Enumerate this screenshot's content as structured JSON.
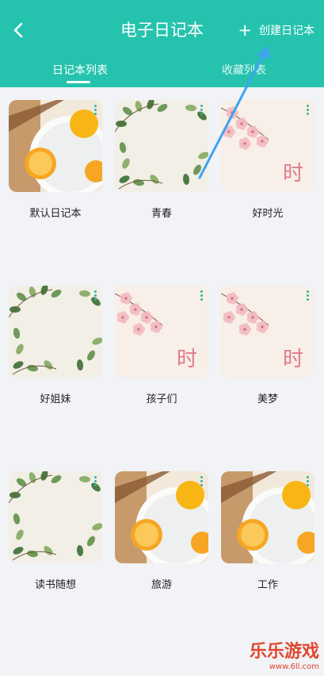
{
  "header": {
    "title": "电子日记本",
    "create_label": "创建日记本",
    "back_icon": "chevron-left-icon"
  },
  "tabs": [
    {
      "label": "日记本列表",
      "active": true
    },
    {
      "label": "收藏列表",
      "active": false
    }
  ],
  "notebooks": [
    {
      "name": "默认日记本",
      "cover": "lemon"
    },
    {
      "name": "青春",
      "cover": "leaves"
    },
    {
      "name": "好时光",
      "cover": "blossom",
      "cover_text": "时"
    },
    {
      "name": "好姐妹",
      "cover": "leaves"
    },
    {
      "name": "孩子们",
      "cover": "blossom",
      "cover_text": "时"
    },
    {
      "name": "美梦",
      "cover": "blossom",
      "cover_text": "时"
    },
    {
      "name": "读书随想",
      "cover": "leaves"
    },
    {
      "name": "旅游",
      "cover": "lemon"
    },
    {
      "name": "工作",
      "cover": "lemon"
    }
  ],
  "watermark": {
    "main": "乐乐游戏",
    "url": "www.6ll.com"
  },
  "colors": {
    "accent": "#25c3ad",
    "annotation_arrow": "#3fa3f2",
    "watermark": "#e2462d"
  }
}
